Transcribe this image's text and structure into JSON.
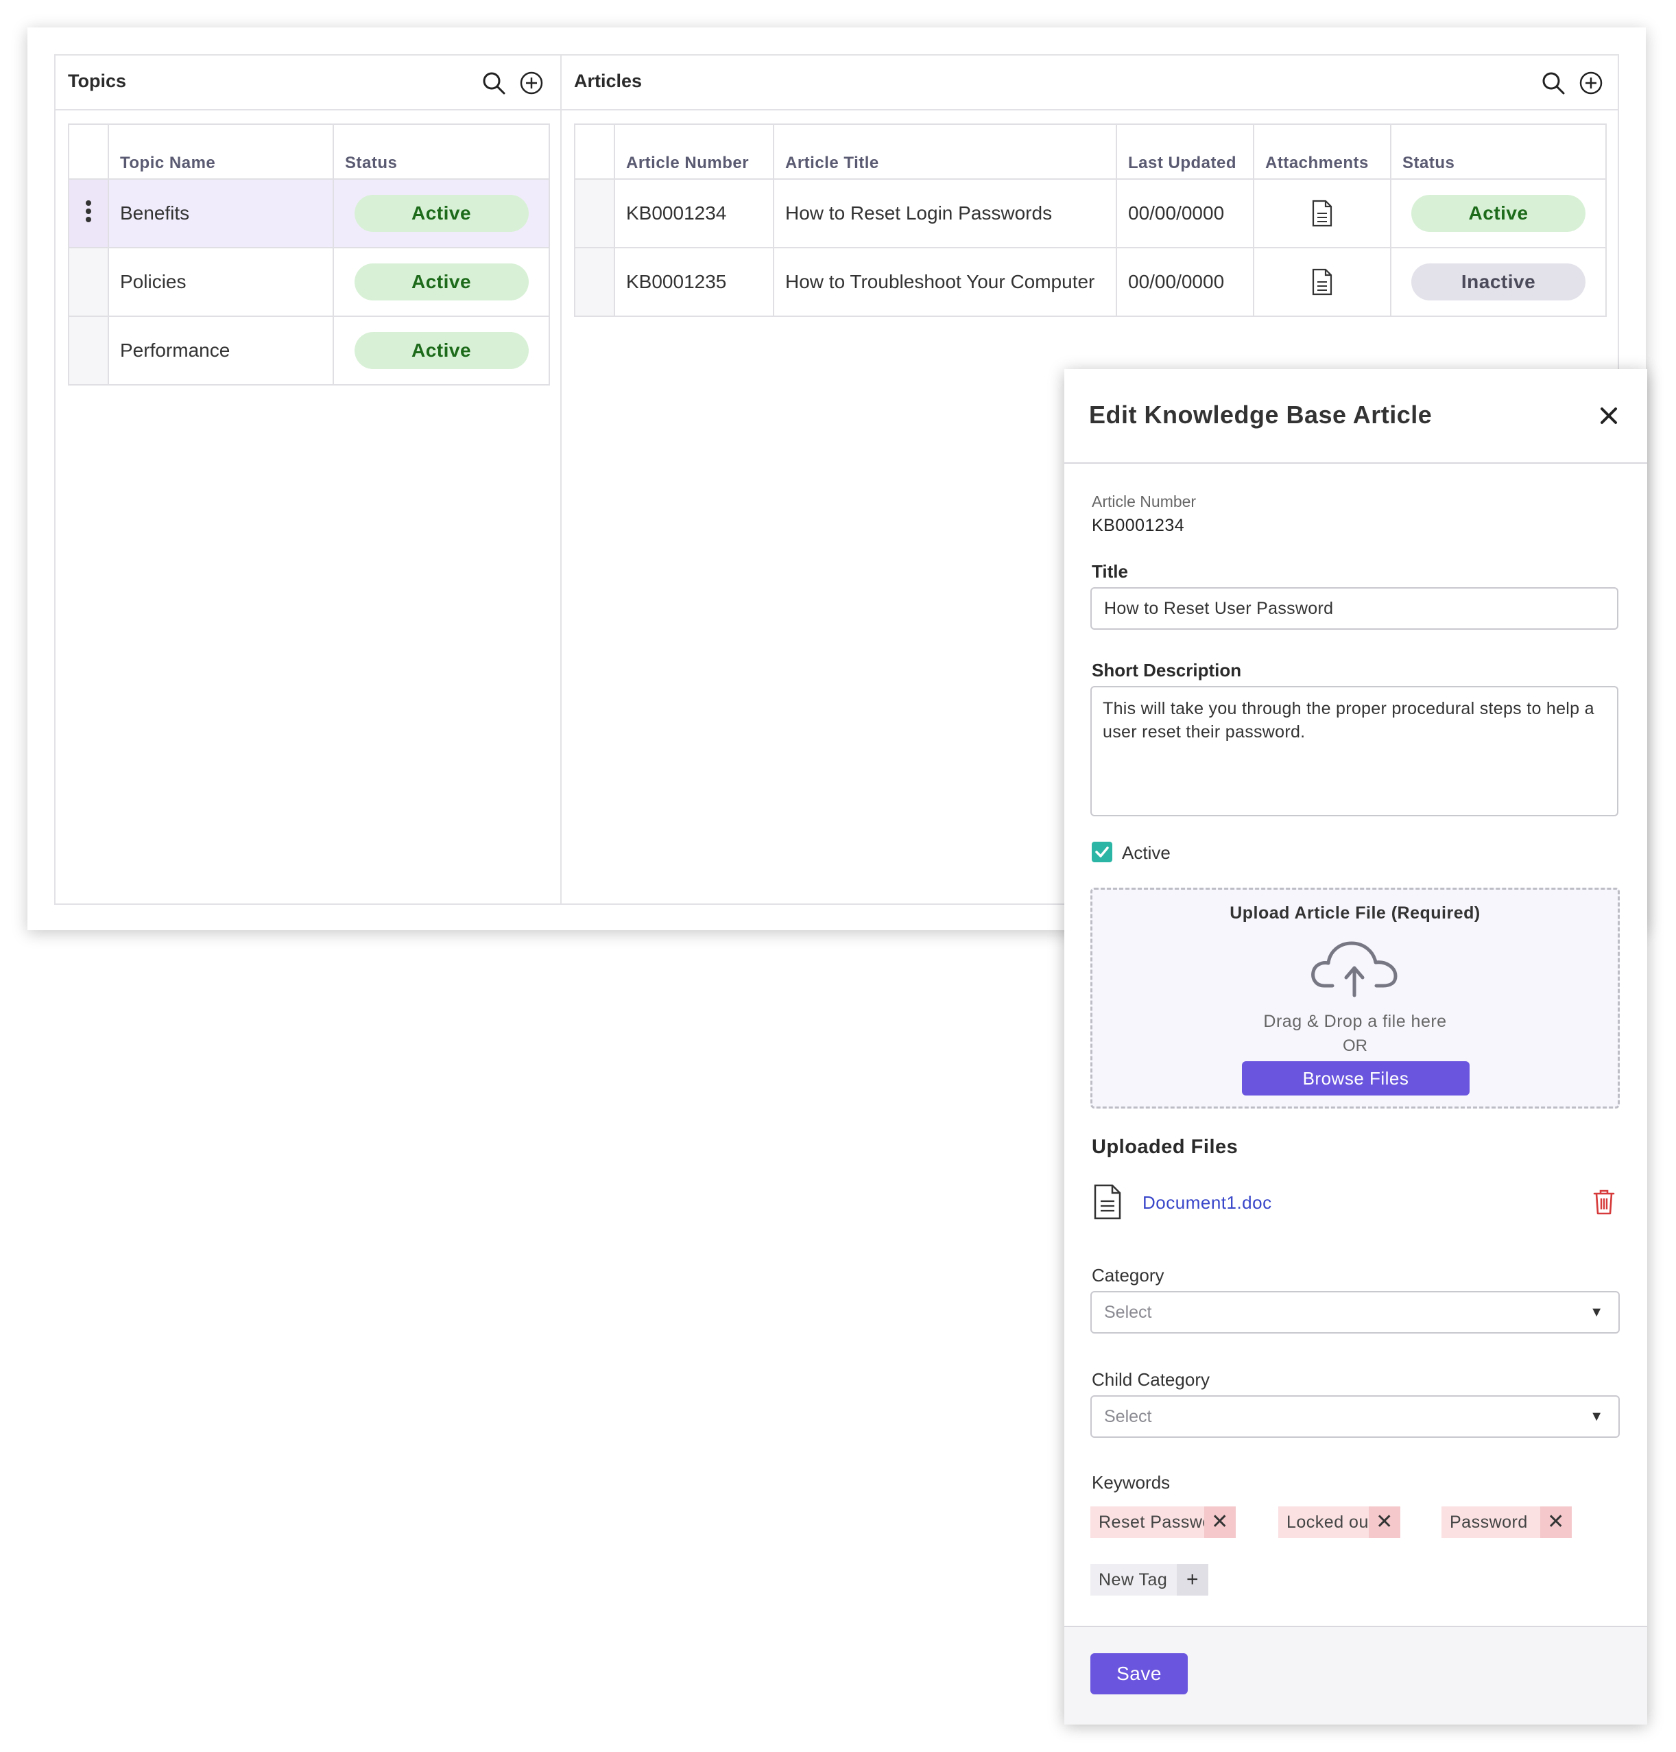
{
  "topics": {
    "title": "Topics",
    "columns": [
      "Topic Name",
      "Status"
    ],
    "rows": [
      {
        "name": "Benefits",
        "status": "Active"
      },
      {
        "name": "Policies",
        "status": "Active"
      },
      {
        "name": "Performance",
        "status": "Active"
      }
    ]
  },
  "articles": {
    "title": "Articles",
    "columns": [
      "Article Number",
      "Article Title",
      "Last Updated",
      "Attachments",
      "Status"
    ],
    "rows": [
      {
        "number": "KB0001234",
        "title": "How to Reset Login Passwords",
        "updated": "00/00/0000",
        "attachment_icon": "document-icon",
        "status": "Active"
      },
      {
        "number": "KB0001235",
        "title": "How to Troubleshoot Your Computer",
        "updated": "00/00/0000",
        "attachment_icon": "document-icon",
        "status": "Inactive"
      }
    ]
  },
  "dialog": {
    "title": "Edit Knowledge Base Article",
    "article_number_label": "Article Number",
    "article_number": "KB0001234",
    "title_label": "Title",
    "title_value": "How to Reset User Password",
    "short_description_label": "Short Description",
    "short_description": "This will take you through the proper procedural steps to help a user reset their password.",
    "active_label": "Active",
    "active_checked": true,
    "upload": {
      "heading": "Upload Article File (Required)",
      "drag_text": "Drag & Drop a file here",
      "or_text": "OR",
      "browse_label": "Browse Files"
    },
    "uploaded_files_label": "Uploaded Files",
    "files": [
      {
        "name": "Document1.doc"
      }
    ],
    "category_label": "Category",
    "category_placeholder": "Select",
    "child_category_label": "Child Category",
    "child_category_placeholder": "Select",
    "keywords_label": "Keywords",
    "keywords": [
      "Reset Password",
      "Locked out",
      "Password"
    ],
    "new_tag_label": "New Tag",
    "save_label": "Save"
  },
  "colors": {
    "accent": "#6a56de",
    "active_bg": "#d8f1d6",
    "active_text": "#1c6a1a",
    "inactive_bg": "#e3e2ea",
    "checkbox": "#2bb5a4",
    "delete": "#d63a3a",
    "tag_bg": "#fbe1e2",
    "selected_row": "#f1ecfb"
  }
}
